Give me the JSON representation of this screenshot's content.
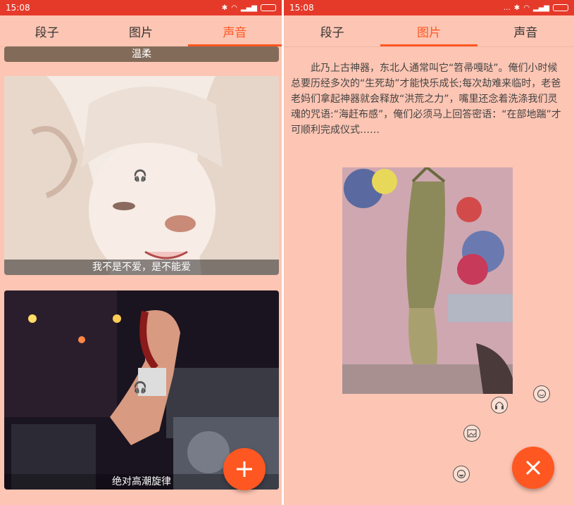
{
  "left": {
    "status_time": "15:08",
    "tabs": [
      "段子",
      "图片",
      "声音"
    ],
    "active_tab": 2,
    "cards": [
      {
        "caption": "温柔"
      },
      {
        "caption": "我不是不爱，是不能爱"
      },
      {
        "caption": "绝对高潮旋律"
      }
    ],
    "fab_icon": "plus-icon"
  },
  "right": {
    "status_time": "15:08",
    "tabs": [
      "段子",
      "图片",
      "声音"
    ],
    "active_tab": 1,
    "description": "此乃上古神器，东北人通常叫它“笤帚嘎哒”。俺们小时候总要历经多次的“生死劫”才能快乐成长;每次劫难来临时，老爸老妈们拿起神器就会释放“洪荒之力”，嘴里还念着洗涤我们灵魂的咒语:“海赶布感”，俺们必须马上回答密语：“在部地踹”才可顺利完成仪式……",
    "fab_icon": "close-icon"
  },
  "colors": {
    "accent": "#ff5722",
    "statusbar": "#e53a2a",
    "background": "#fdc5b3"
  }
}
